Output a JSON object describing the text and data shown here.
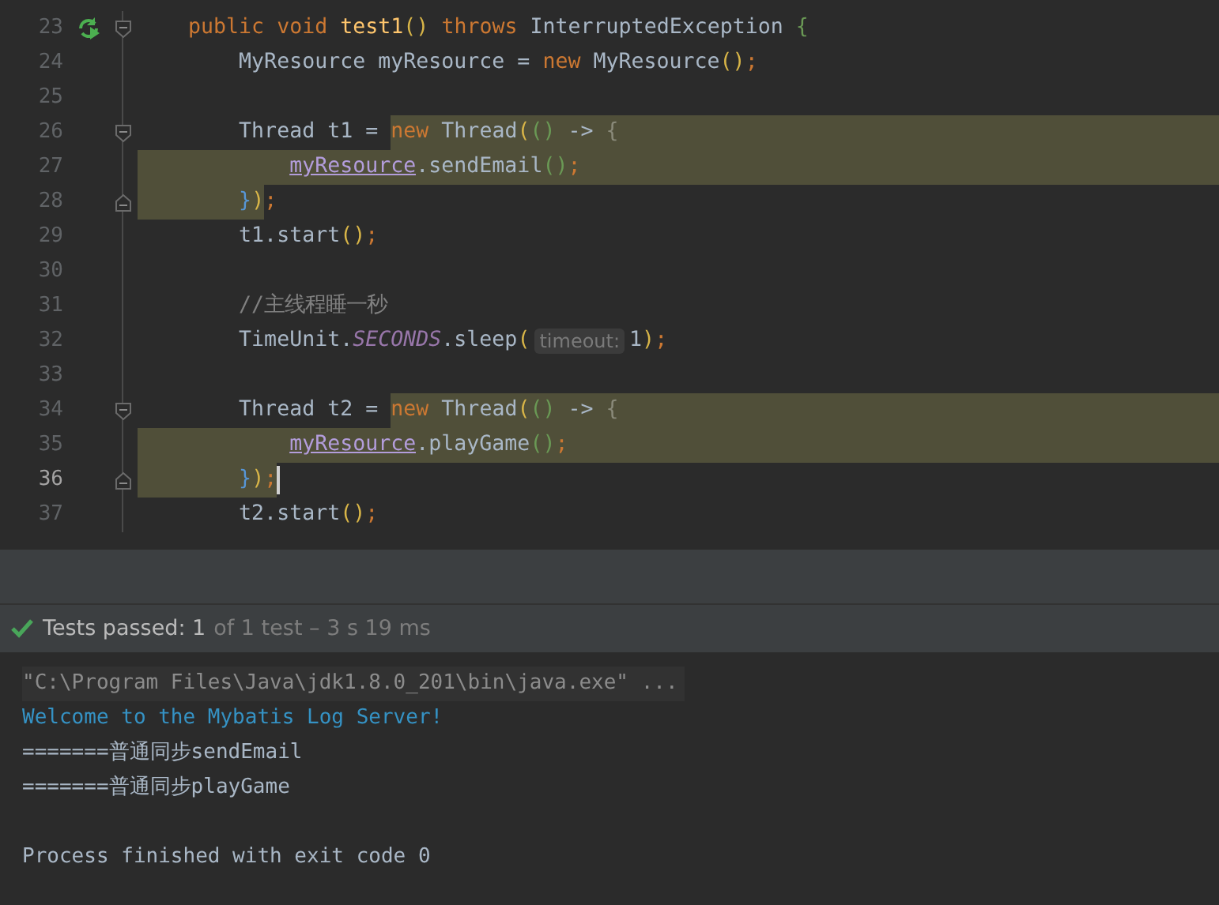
{
  "editor": {
    "lines": [
      {
        "number": "23",
        "run_icon": true,
        "fold_start": true,
        "fold_end": false,
        "current": false,
        "caret": false,
        "hl_rest": false,
        "tokens": [
          {
            "text": "    public",
            "kind": "kw"
          },
          {
            "text": " void",
            "kind": "kw"
          },
          {
            "text": " test1",
            "kind": "decl"
          },
          {
            "text": "()",
            "kind": "py"
          },
          {
            "text": " throws",
            "kind": "kw"
          },
          {
            "text": " InterruptedException ",
            "kind": "plain"
          },
          {
            "text": "{",
            "kind": "pg"
          }
        ]
      },
      {
        "number": "24",
        "run_icon": false,
        "fold_start": false,
        "fold_end": false,
        "current": false,
        "caret": false,
        "hl_rest": false,
        "tokens": [
          {
            "text": "        MyResource myResource = ",
            "kind": "plain"
          },
          {
            "text": "new",
            "kind": "kw"
          },
          {
            "text": " MyResource",
            "kind": "plain"
          },
          {
            "text": "()",
            "kind": "py"
          },
          {
            "text": ";",
            "kind": "semi"
          }
        ]
      },
      {
        "number": "25",
        "run_icon": false,
        "fold_start": false,
        "fold_end": false,
        "current": false
      },
      {
        "number": "26",
        "run_icon": false,
        "fold_start": true,
        "fold_end": false,
        "current": false,
        "caret": false,
        "hl_rest": true,
        "tokens": [
          {
            "text": "        Thread t1 = ",
            "kind": "plain"
          }
        ],
        "highlighted": [
          {
            "text": "new",
            "kind": "kw"
          },
          {
            "text": " Thread",
            "kind": "plain"
          },
          {
            "text": "(",
            "kind": "py"
          },
          {
            "text": "()",
            "kind": "pg"
          },
          {
            "text": " -> ",
            "kind": "plain"
          },
          {
            "text": "{",
            "kind": "dim"
          }
        ]
      },
      {
        "number": "27",
        "run_icon": false,
        "fold_start": false,
        "fold_end": false,
        "current": false,
        "caret": false,
        "hl_rest": true,
        "highlighted": [
          {
            "text": "            myResource",
            "kind": "field"
          },
          {
            "text": ".sendEmail",
            "kind": "plain"
          },
          {
            "text": "()",
            "kind": "pg"
          },
          {
            "text": ";",
            "kind": "semi"
          }
        ]
      },
      {
        "number": "28",
        "run_icon": false,
        "fold_start": false,
        "fold_end": true,
        "current": false,
        "caret": false,
        "hl_rest": false,
        "highlighted": [
          {
            "text": "        }",
            "kind": "pb"
          },
          {
            "text": ")",
            "kind": "py"
          }
        ],
        "after": [
          {
            "text": ";",
            "kind": "semi"
          }
        ]
      },
      {
        "number": "29",
        "run_icon": false,
        "fold_start": false,
        "fold_end": false,
        "current": false,
        "caret": false,
        "hl_rest": false,
        "tokens": [
          {
            "text": "        t1.start",
            "kind": "plain"
          },
          {
            "text": "()",
            "kind": "py"
          },
          {
            "text": ";",
            "kind": "semi"
          }
        ]
      },
      {
        "number": "30",
        "run_icon": false,
        "fold_start": false,
        "fold_end": false,
        "current": false
      },
      {
        "number": "31",
        "run_icon": false,
        "fold_start": false,
        "fold_end": false,
        "current": false,
        "caret": false,
        "hl_rest": false,
        "tokens": [
          {
            "text": "        //主线程睡一秒",
            "kind": "comment"
          }
        ]
      },
      {
        "number": "32",
        "run_icon": false,
        "fold_start": false,
        "fold_end": false,
        "current": false,
        "caret": false,
        "hl_rest": false,
        "tokens": [
          {
            "text": "        TimeUnit.",
            "kind": "plain"
          },
          {
            "text": "SECONDS",
            "kind": "static"
          },
          {
            "text": ".sleep",
            "kind": "plain"
          },
          {
            "text": "(",
            "kind": "py"
          },
          {
            "text": "timeout:",
            "kind": "hint"
          },
          {
            "text": "1",
            "kind": "num"
          },
          {
            "text": ")",
            "kind": "py"
          },
          {
            "text": ";",
            "kind": "semi"
          }
        ]
      },
      {
        "number": "33",
        "run_icon": false,
        "fold_start": false,
        "fold_end": false,
        "current": false
      },
      {
        "number": "34",
        "run_icon": false,
        "fold_start": true,
        "fold_end": false,
        "current": false,
        "caret": false,
        "hl_rest": true,
        "tokens": [
          {
            "text": "        Thread t2 = ",
            "kind": "plain"
          }
        ],
        "highlighted": [
          {
            "text": "new",
            "kind": "kw"
          },
          {
            "text": " Thread",
            "kind": "plain"
          },
          {
            "text": "(",
            "kind": "py"
          },
          {
            "text": "()",
            "kind": "pg"
          },
          {
            "text": " -> ",
            "kind": "plain"
          },
          {
            "text": "{",
            "kind": "dim"
          }
        ]
      },
      {
        "number": "35",
        "run_icon": false,
        "fold_start": false,
        "fold_end": false,
        "current": false,
        "caret": false,
        "hl_rest": true,
        "highlighted": [
          {
            "text": "            myResource",
            "kind": "field"
          },
          {
            "text": ".playGame",
            "kind": "plain"
          },
          {
            "text": "()",
            "kind": "pg"
          },
          {
            "text": ";",
            "kind": "semi"
          }
        ]
      },
      {
        "number": "36",
        "run_icon": false,
        "fold_start": false,
        "fold_end": true,
        "current": true,
        "caret": true,
        "hl_rest": false,
        "highlighted": [
          {
            "text": "        }",
            "kind": "pb"
          },
          {
            "text": ")",
            "kind": "py"
          },
          {
            "text": ";",
            "kind": "semi"
          }
        ]
      },
      {
        "number": "37",
        "run_icon": false,
        "fold_start": false,
        "fold_end": false,
        "current": false,
        "caret": false,
        "hl_rest": false,
        "tokens": [
          {
            "text": "        t2.start",
            "kind": "plain"
          },
          {
            "text": "()",
            "kind": "py"
          },
          {
            "text": ";",
            "kind": "semi"
          }
        ]
      }
    ]
  },
  "test_status": {
    "passed": true,
    "summary": "Tests passed: 1",
    "detail": "of 1 test – 3 s 19 ms"
  },
  "console": {
    "lines": [
      {
        "kind": "cmd",
        "text": "\"C:\\Program Files\\Java\\jdk1.8.0_201\\bin\\java.exe\" ..."
      },
      {
        "kind": "info",
        "text": "Welcome to the Mybatis Log Server!"
      },
      {
        "kind": "out",
        "text": "=======普通同步sendEmail"
      },
      {
        "kind": "out",
        "text": "=======普通同步playGame"
      },
      {
        "kind": "exit",
        "text": "Process finished with exit code 0"
      }
    ]
  }
}
